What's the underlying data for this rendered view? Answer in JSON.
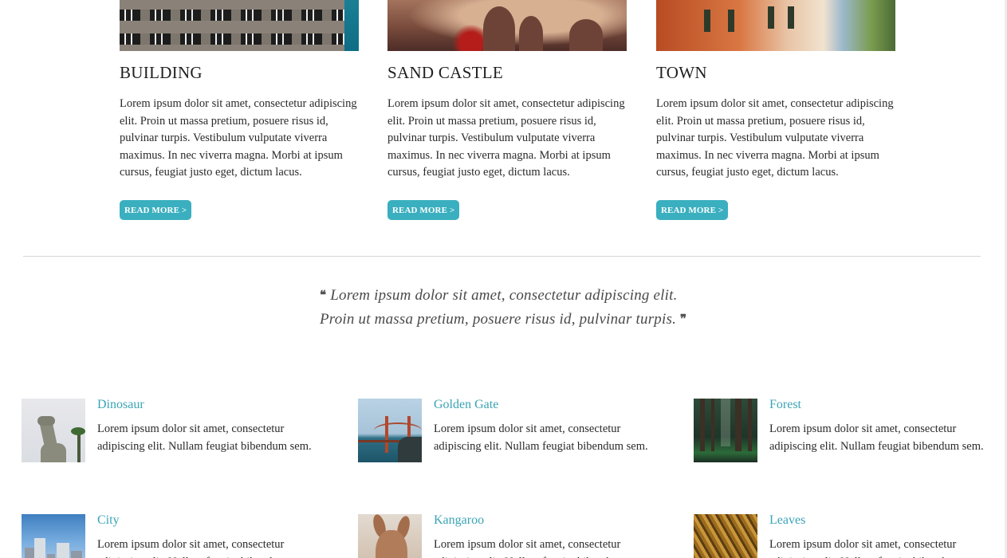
{
  "cards": [
    {
      "title": "BUILDING",
      "text": "Lorem ipsum dolor sit amet, consectetur adipiscing elit. Proin ut massa pretium, posuere risus id, pulvinar turpis. Vestibulum vulputate viverra maximus. In nec viverra magna. Morbi at ipsum cursus, feugiat justo eget, dictum lacus.",
      "button": "READ MORE >"
    },
    {
      "title": "SAND CASTLE",
      "text": "Lorem ipsum dolor sit amet, consectetur adipiscing elit. Proin ut massa pretium, posuere risus id, pulvinar turpis. Vestibulum vulputate viverra maximus. In nec viverra magna. Morbi at ipsum cursus, feugiat justo eget, dictum lacus.",
      "button": "READ MORE >"
    },
    {
      "title": "TOWN",
      "text": "Lorem ipsum dolor sit amet, consectetur adipiscing elit. Proin ut massa pretium, posuere risus id, pulvinar turpis. Vestibulum vulputate viverra maximus. In nec viverra magna. Morbi at ipsum cursus, feugiat justo eget, dictum lacus.",
      "button": "READ MORE >"
    }
  ],
  "quote": {
    "open_mark": "❝",
    "text": "Lorem ipsum dolor sit amet, consectetur adipiscing elit. Proin ut massa pretium, posuere risus id, pulvinar turpis.",
    "close_mark": "❞"
  },
  "items": [
    {
      "title": "Dinosaur",
      "text": "Lorem ipsum dolor sit amet, consectetur adipiscing elit. Nullam feugiat bibendum sem.",
      "icon": "dinosaur-thumbnail"
    },
    {
      "title": "Golden Gate",
      "text": "Lorem ipsum dolor sit amet, consectetur adipiscing elit. Nullam feugiat bibendum sem.",
      "icon": "golden-gate-thumbnail"
    },
    {
      "title": "Forest",
      "text": "Lorem ipsum dolor sit amet, consectetur adipiscing elit. Nullam feugiat bibendum sem.",
      "icon": "forest-thumbnail"
    },
    {
      "title": "City",
      "text": "Lorem ipsum dolor sit amet, consectetur adipiscing elit. Nullam feugiat bibendum sem.",
      "icon": "city-thumbnail"
    },
    {
      "title": "Kangaroo",
      "text": "Lorem ipsum dolor sit amet, consectetur adipiscing elit. Nullam feugiat bibendum sem.",
      "icon": "kangaroo-thumbnail"
    },
    {
      "title": "Leaves",
      "text": "Lorem ipsum dolor sit amet, consectetur adipiscing elit. Nullam feugiat bibendum sem.",
      "icon": "leaves-thumbnail"
    }
  ],
  "colors": {
    "accent": "#3aafbf",
    "link": "#3aa4b5",
    "divider": "#d6d6d6"
  }
}
